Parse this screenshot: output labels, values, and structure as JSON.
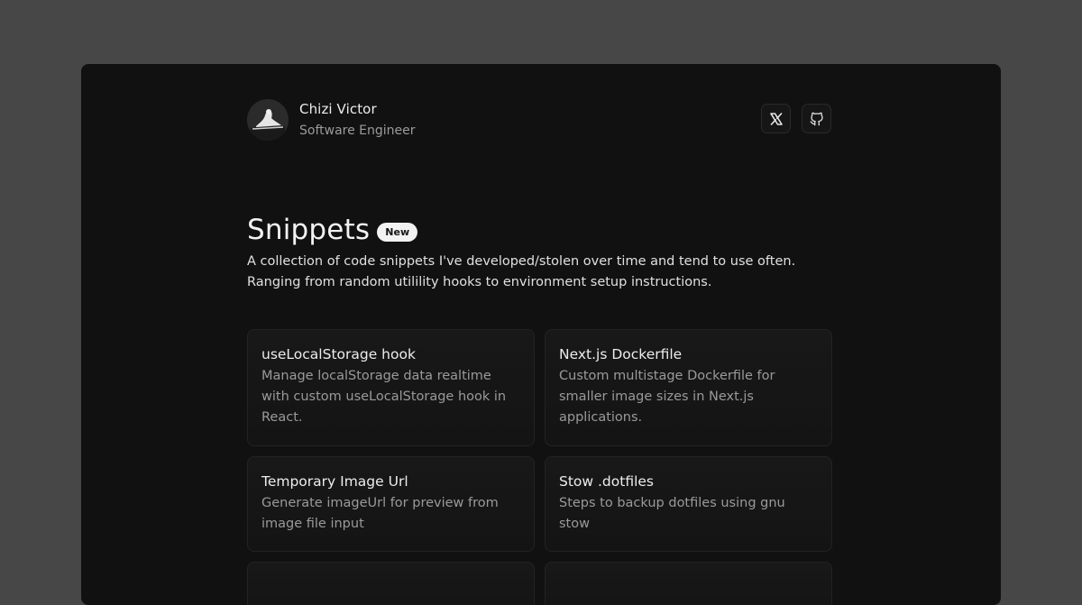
{
  "profile": {
    "name": "Chizi Victor",
    "role": "Software Engineer",
    "avatar_icon": "avatar-photo"
  },
  "socials": [
    {
      "icon": "x-icon",
      "label": "X"
    },
    {
      "icon": "github-icon",
      "label": "GitHub"
    }
  ],
  "page": {
    "title": "Snippets",
    "badge": "New",
    "description_line1": "A collection of code snippets I've developed/stolen over time and tend to use often.",
    "description_line2": "Ranging from random utilility hooks to environment setup instructions."
  },
  "snippets": [
    {
      "title": "useLocalStorage hook",
      "desc_lines": [
        "Manage localStorage data realtime",
        "with custom useLocalStorage hook in",
        "React."
      ]
    },
    {
      "title": "Next.js Dockerfile",
      "desc_lines": [
        "Custom multistage Dockerfile for",
        "smaller image sizes in Next.js",
        "applications."
      ]
    },
    {
      "title": "Temporary Image Url",
      "desc_lines": [
        "Generate imageUrl for preview from",
        "image file input"
      ]
    },
    {
      "title": "Stow .dotfiles",
      "desc_lines": [
        "Steps to backup dotfiles using gnu",
        "stow"
      ]
    }
  ],
  "colors": {
    "background": "#474747",
    "window": "#111111",
    "badge": "#f2f2f2"
  }
}
